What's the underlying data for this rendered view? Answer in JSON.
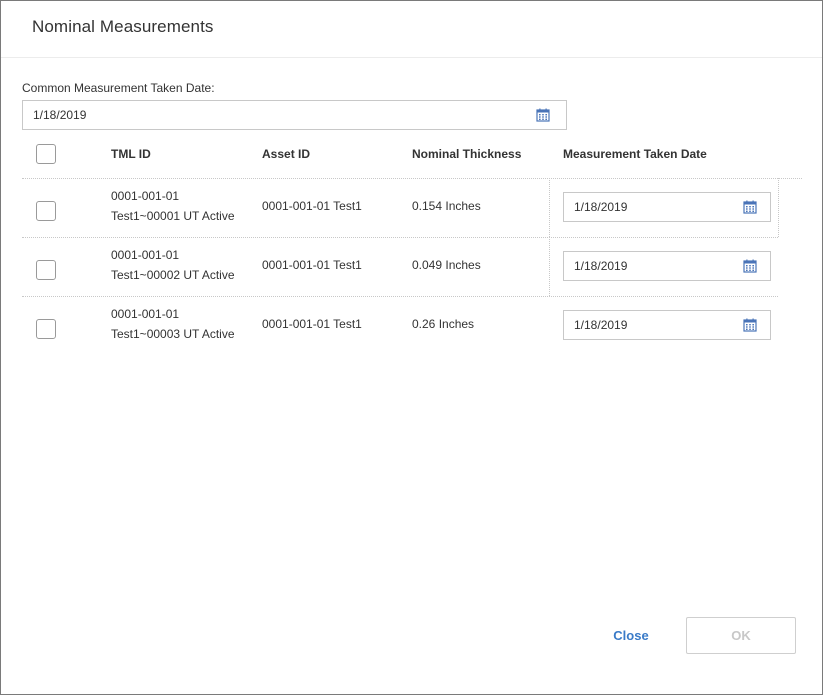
{
  "dialog": {
    "title": "Nominal Measurements"
  },
  "common_date": {
    "label": "Common Measurement Taken Date:",
    "value": "1/18/2019",
    "icon": "calendar-icon"
  },
  "table": {
    "columns": [
      "TML ID",
      "Asset ID",
      "Nominal Thickness",
      "Measurement Taken Date"
    ],
    "rows": [
      {
        "tml_id_line1": "0001-001-01",
        "tml_id_line2": "Test1~00001 UT Active",
        "asset_id": "0001-001-01 Test1",
        "nominal_thickness": "0.154 Inches",
        "measurement_date": "1/18/2019"
      },
      {
        "tml_id_line1": "0001-001-01",
        "tml_id_line2": "Test1~00002 UT Active",
        "asset_id": "0001-001-01 Test1",
        "nominal_thickness": "0.049 Inches",
        "measurement_date": "1/18/2019"
      },
      {
        "tml_id_line1": "0001-001-01",
        "tml_id_line2": "Test1~00003 UT Active",
        "asset_id": "0001-001-01 Test1",
        "nominal_thickness": "0.26 Inches",
        "measurement_date": "1/18/2019"
      }
    ]
  },
  "footer": {
    "close_label": "Close",
    "ok_label": "OK"
  },
  "colors": {
    "accent": "#3a7bc8",
    "icon": "#4a74b8",
    "disabled_text": "#c8c8c8"
  }
}
